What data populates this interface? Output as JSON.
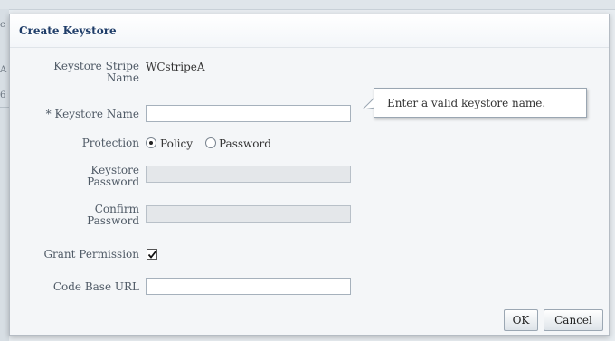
{
  "background": {
    "fragment_1": "c",
    "fragment_2": "A",
    "fragment_3": "6"
  },
  "dialog": {
    "title": "Create Keystore",
    "stripe_label_line1": "Keystore Stripe",
    "stripe_label_line2": "Name",
    "stripe_value": "WCstripeA",
    "keystore_name_label": "* Keystore Name",
    "keystore_name_value": "",
    "tooltip": "Enter a valid keystore name.",
    "protection_label": "Protection",
    "protection_options": [
      "Policy",
      "Password"
    ],
    "protection_selected": "Policy",
    "keystore_password_label_line1": "Keystore",
    "keystore_password_label_line2": "Password",
    "confirm_password_label_line1": "Confirm",
    "confirm_password_label_line2": "Password",
    "grant_permission_label": "Grant Permission",
    "grant_permission_checked": true,
    "code_base_url_label": "Code Base URL",
    "code_base_url_value": "",
    "ok_label": "OK",
    "cancel_label": "Cancel"
  }
}
